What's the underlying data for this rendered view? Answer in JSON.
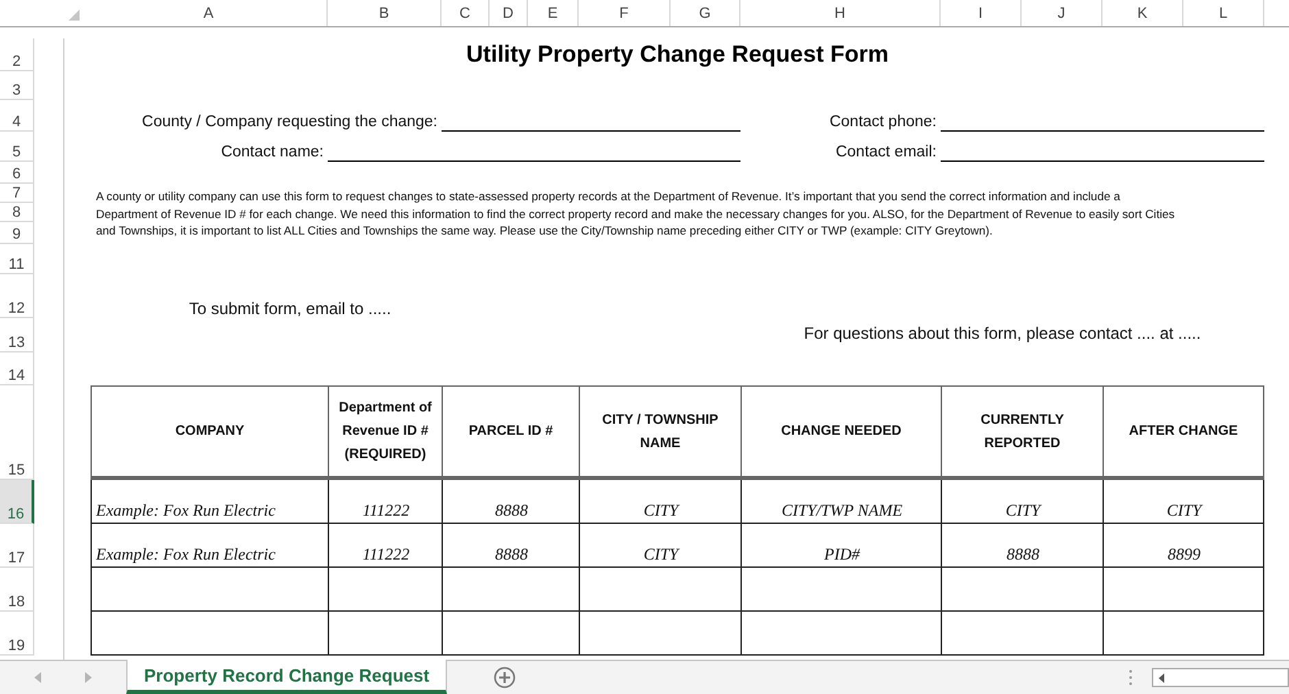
{
  "column_headers": [
    "A",
    "B",
    "C",
    "D",
    "E",
    "F",
    "G",
    "H",
    "I",
    "J",
    "K",
    "L"
  ],
  "row_numbers": [
    {
      "label": "2",
      "selected": false
    },
    {
      "label": "3",
      "selected": false
    },
    {
      "label": "4",
      "selected": false
    },
    {
      "label": "5",
      "selected": false
    },
    {
      "label": "6",
      "selected": false
    },
    {
      "label": "7",
      "selected": false
    },
    {
      "label": "8",
      "selected": false
    },
    {
      "label": "9",
      "selected": false
    },
    {
      "label": "11",
      "selected": false
    },
    {
      "label": "12",
      "selected": false
    },
    {
      "label": "13",
      "selected": false
    },
    {
      "label": "14",
      "selected": false
    },
    {
      "label": "15",
      "selected": false
    },
    {
      "label": "16",
      "selected": true
    },
    {
      "label": "17",
      "selected": false
    },
    {
      "label": "18",
      "selected": false
    },
    {
      "label": "19",
      "selected": false
    }
  ],
  "title": "Utility Property Change Request Form",
  "field_rows": [
    [
      {
        "label": "County / Company requesting the change:"
      },
      {
        "label": "Contact phone:"
      }
    ],
    [
      {
        "label": "Contact name:"
      },
      {
        "label": "Contact email:"
      }
    ]
  ],
  "instructions": "A county or utility company can use this form to request changes to state-assessed property records at the Department of Revenue.  It’s important that you send the correct information and include a Department of Revenue ID # for each change.  We need this information to find the correct property record and make the necessary changes for you. ALSO,  for the Department of Revenue to easily sort Cities and Townships, it is important to list ALL Cities and Townships  the same way. Please use the City/Township name preceding either CITY or TWP (example: CITY Greytown).",
  "submit_note": "To submit form, email to .....",
  "questions_note": "For questions about this form, please contact .... at   .....",
  "table": {
    "columns": [
      "COMPANY",
      "Department of Revenue ID # (REQUIRED)",
      "PARCEL ID #",
      "CITY / TOWNSHIP NAME",
      "CHANGE NEEDED",
      "CURRENTLY REPORTED",
      "AFTER CHANGE"
    ],
    "rows": [
      [
        "Example: Fox Run Electric",
        "111222",
        "8888",
        "CITY",
        "CITY/TWP NAME",
        "CITY",
        "CITY"
      ],
      [
        "Example: Fox Run Electric",
        "111222",
        "8888",
        "CITY",
        "PID#",
        "8888",
        "8899"
      ]
    ]
  },
  "sheet_tabs": [
    {
      "label": "Property Record Change Request",
      "selected": true
    }
  ]
}
